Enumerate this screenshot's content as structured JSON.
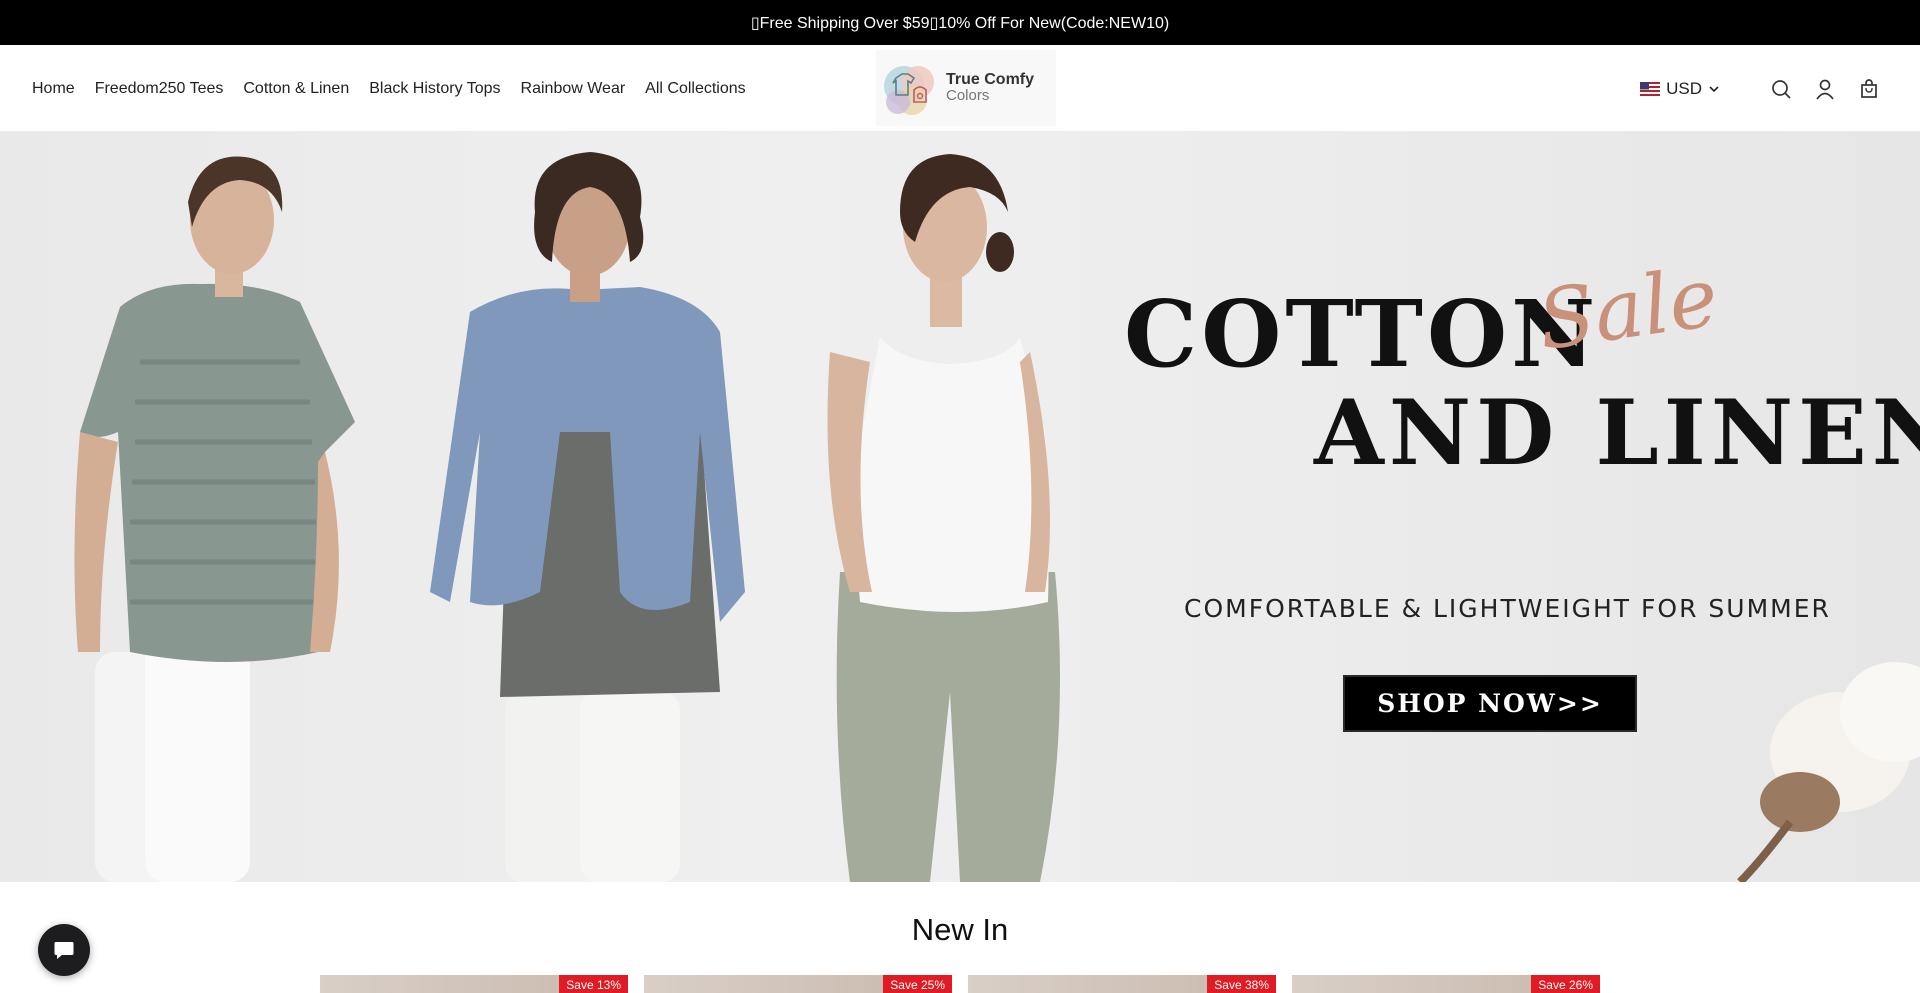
{
  "announcement": {
    "text": "▯Free Shipping Over $59▯10% Off For New(Code:NEW10)"
  },
  "nav": {
    "items": [
      {
        "label": "Home"
      },
      {
        "label": "Freedom250 Tees"
      },
      {
        "label": "Cotton & Linen"
      },
      {
        "label": "Black History Tops"
      },
      {
        "label": "Rainbow Wear"
      },
      {
        "label": "All Collections"
      }
    ]
  },
  "logo": {
    "line1": "True Comfy",
    "line2": "Colors"
  },
  "header": {
    "currency": "USD",
    "icons": [
      "search-icon",
      "account-icon",
      "cart-icon"
    ]
  },
  "hero": {
    "headline_1": "COTTON",
    "script_word": "Sale",
    "headline_2": "AND LINEN",
    "subheadline": "COMFORTABLE & LIGHTWEIGHT FOR SUMMER",
    "cta": "SHOP NOW>>"
  },
  "new_in": {
    "title": "New In",
    "products": [
      {
        "badge": "Save 13%"
      },
      {
        "badge": "Save 25%"
      },
      {
        "badge": "Save 38%"
      },
      {
        "badge": "Save 26%"
      }
    ]
  },
  "colors": {
    "announcement_bg": "#000000",
    "sale_badge": "#e01b24",
    "script_accent": "#c9907a",
    "cta_bg": "#000000"
  }
}
